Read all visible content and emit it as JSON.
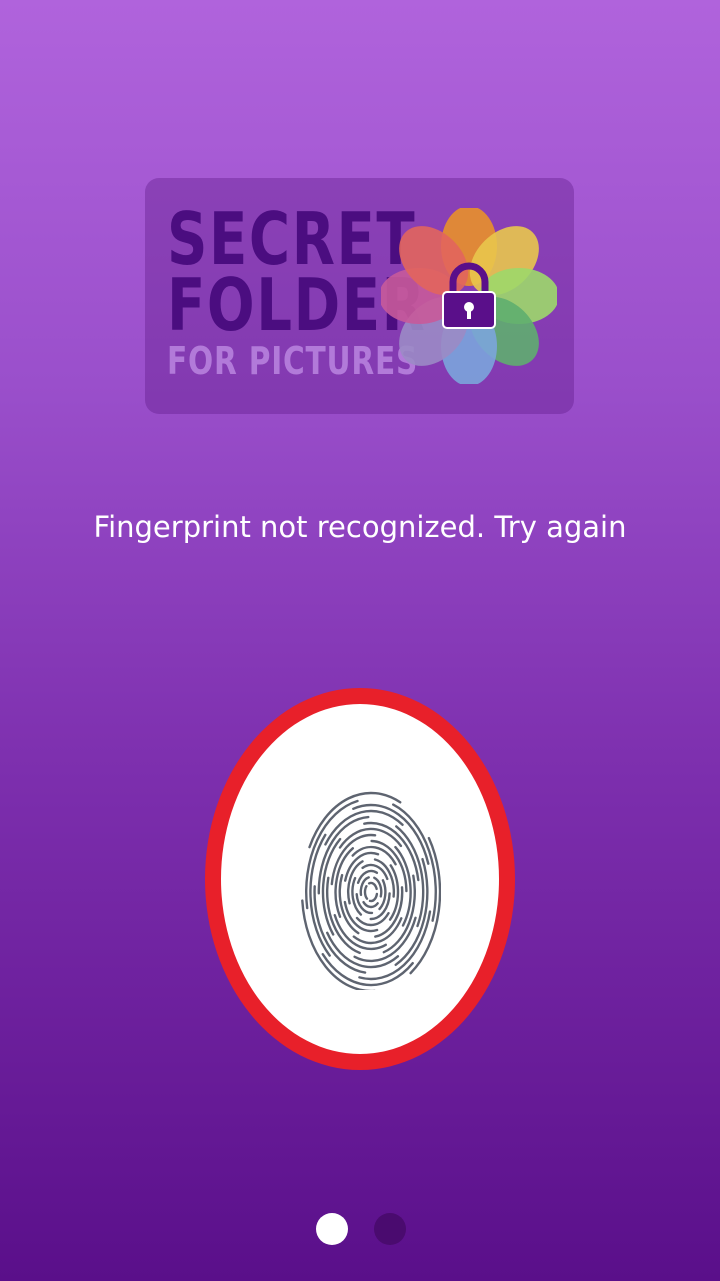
{
  "logo": {
    "line1": "SECRET",
    "line2": "FOLDER",
    "line3": "FOR PICTURES",
    "icon": "lock-flower-icon",
    "petal_colors": [
      "#e9902a",
      "#e9c64d",
      "#9dd86a",
      "#5fae6f",
      "#7ba5dc",
      "#9b8bc5",
      "#c85a9a",
      "#e2655d"
    ],
    "lock_color": "#5a0f8a"
  },
  "status": {
    "message": "Fingerprint not recognized. Try again",
    "state": "error"
  },
  "fingerprint_button": {
    "icon": "fingerprint-icon",
    "ring_color": "#e8202a"
  },
  "pager": {
    "pages": 2,
    "current_page": 1
  },
  "colors": {
    "background_top": "#b063dc",
    "background_bottom": "#5a0f8a",
    "text": "#ffffff"
  }
}
